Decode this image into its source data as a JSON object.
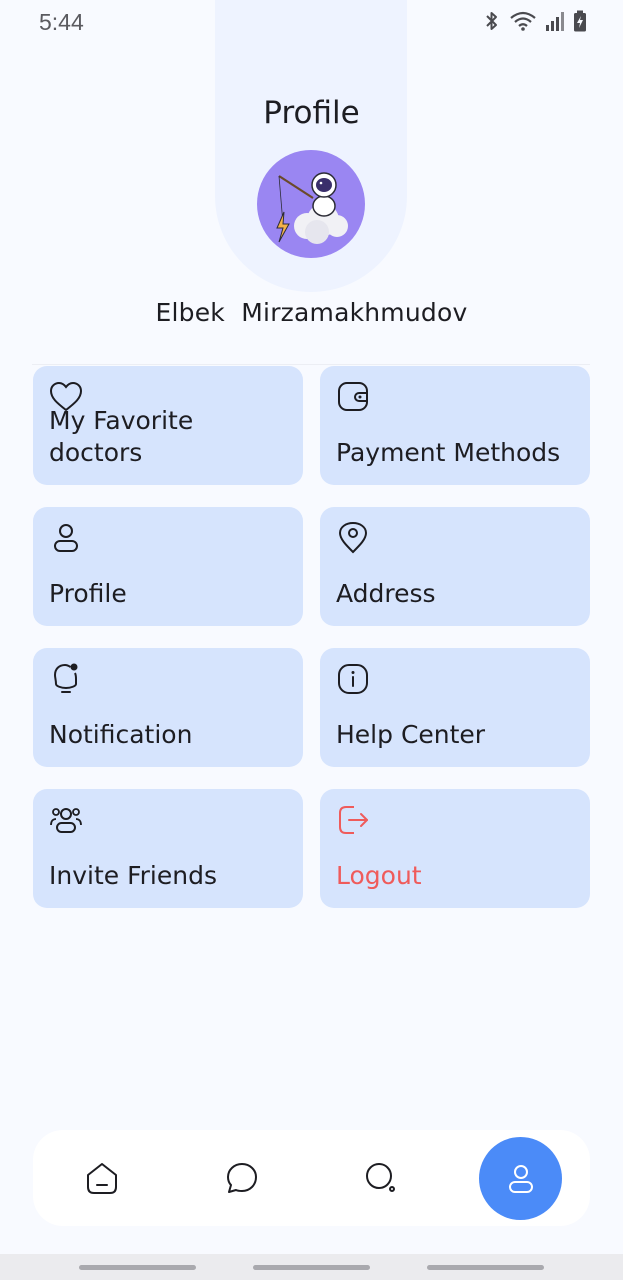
{
  "status_bar": {
    "time": "5:44"
  },
  "header": {
    "title": "Profile"
  },
  "profile": {
    "name": "Elbek  Mirzamakhmudov"
  },
  "menu": [
    {
      "label": "My Favorite doctors",
      "icon": "heart-icon"
    },
    {
      "label": "Payment Methods",
      "icon": "wallet-icon"
    },
    {
      "label": "Profile",
      "icon": "user-icon"
    },
    {
      "label": "Address",
      "icon": "location-pin-icon"
    },
    {
      "label": "Notification",
      "icon": "bell-icon"
    },
    {
      "label": "Help Center",
      "icon": "info-icon"
    },
    {
      "label": "Invite Friends",
      "icon": "users-icon"
    },
    {
      "label": "Logout",
      "icon": "logout-icon"
    }
  ],
  "bottom_nav": {
    "items": [
      "home-icon",
      "chat-icon",
      "search-icon",
      "profile-icon"
    ],
    "active": "profile-icon"
  },
  "colors": {
    "card": "#d6e4fd",
    "accent": "#4b8bf8",
    "logout": "#ef5b5b",
    "avatar_bg": "#9a86f2"
  }
}
